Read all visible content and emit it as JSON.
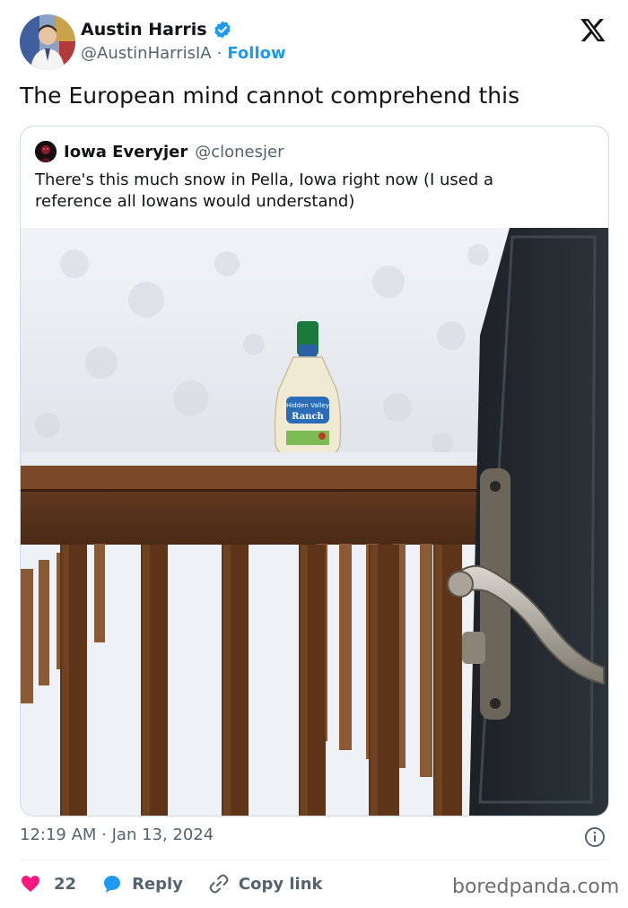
{
  "author": {
    "display_name": "Austin Harris",
    "handle": "@AustinHarrisIA",
    "separator": "·",
    "follow_label": "Follow",
    "verified_icon": "verified-badge-icon"
  },
  "tweet": {
    "text": "The European mind cannot comprehend this"
  },
  "quoted": {
    "display_name": "Iowa Everyjer",
    "handle": "@clonesjer",
    "text": "There's this much snow in Pella, Iowa right now (I used a\nreference all Iowans would understand)",
    "photo": {
      "bottle_brand": "Hidden Valley",
      "bottle_label": "Ranch"
    }
  },
  "meta": {
    "timestamp": "12:19 AM · Jan 13, 2024"
  },
  "actions": {
    "likes_count": "22",
    "reply_label": "Reply",
    "copy_link_label": "Copy link"
  },
  "watermark": "boredpanda.com",
  "colors": {
    "accent": "#1d9bf0",
    "like": "#f91880",
    "secondary_text": "#536471"
  }
}
